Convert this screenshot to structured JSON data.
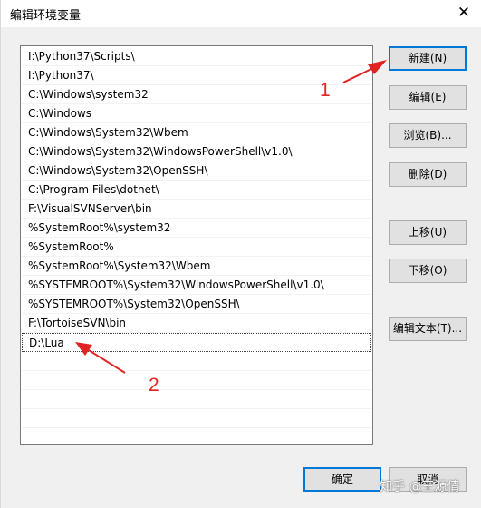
{
  "window": {
    "title": "编辑环境变量",
    "close_glyph": "✕"
  },
  "path_list": {
    "items": [
      "I:\\Python37\\Scripts\\",
      "I:\\Python37\\",
      "C:\\Windows\\system32",
      "C:\\Windows",
      "C:\\Windows\\System32\\Wbem",
      "C:\\Windows\\System32\\WindowsPowerShell\\v1.0\\",
      "C:\\Windows\\System32\\OpenSSH\\",
      "C:\\Program Files\\dotnet\\",
      "F:\\VisualSVNServer\\bin",
      "%SystemRoot%\\system32",
      "%SystemRoot%",
      "%SystemRoot%\\System32\\Wbem",
      "%SYSTEMROOT%\\System32\\WindowsPowerShell\\v1.0\\",
      "%SYSTEMROOT%\\System32\\OpenSSH\\",
      "F:\\TortoiseSVN\\bin"
    ],
    "editing_value": "D:\\Lua"
  },
  "buttons": {
    "new": "新建(N)",
    "edit": "编辑(E)",
    "browse": "浏览(B)...",
    "delete": "删除(D)",
    "move_up": "上移(U)",
    "move_down": "下移(O)",
    "edit_text": "编辑文本(T)...",
    "ok": "确定",
    "cancel": "取消"
  },
  "annotations": {
    "one": "1",
    "two": "2",
    "color": "#e32222"
  },
  "watermark": "知乎 @王源倩"
}
